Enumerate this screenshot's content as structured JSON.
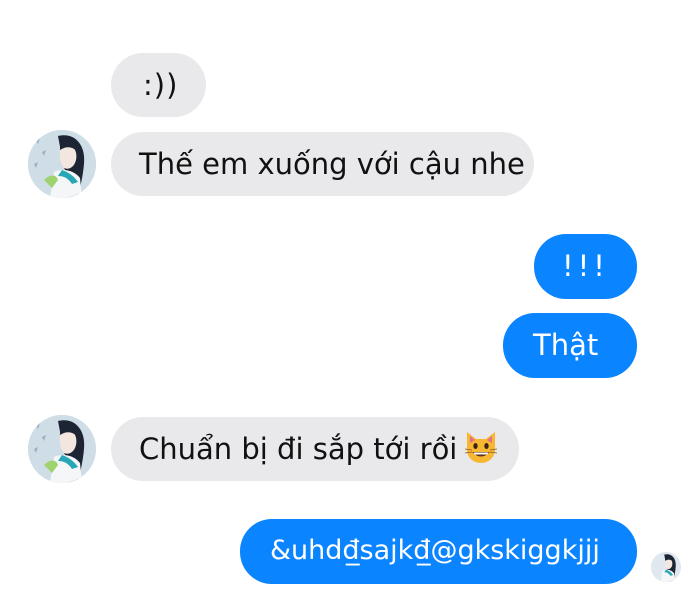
{
  "conversation": {
    "messages": [
      {
        "id": "m1",
        "side": "incoming",
        "text": ":))"
      },
      {
        "id": "m2",
        "side": "incoming",
        "text": "Thế em xuống với cậu nhe"
      },
      {
        "id": "m3",
        "side": "outgoing",
        "text": "!!!"
      },
      {
        "id": "m4",
        "side": "outgoing",
        "text": "Thật"
      },
      {
        "id": "m5",
        "side": "incoming",
        "text": "Chuẩn bị đi sắp tới rồi",
        "emoji": "grinning-cat-face"
      },
      {
        "id": "m6",
        "side": "outgoing",
        "text": "&uhdđ̲sajkđ̲@gkskiggkjjj"
      }
    ],
    "contact_avatar_icon": "anime-girl-avatar",
    "read_receipt_icon": "anime-girl-avatar-small"
  },
  "colors": {
    "incoming_bubble": "#e9e9eb",
    "outgoing_bubble": "#0b84ff",
    "incoming_text": "#111111",
    "outgoing_text": "#ffffff"
  }
}
